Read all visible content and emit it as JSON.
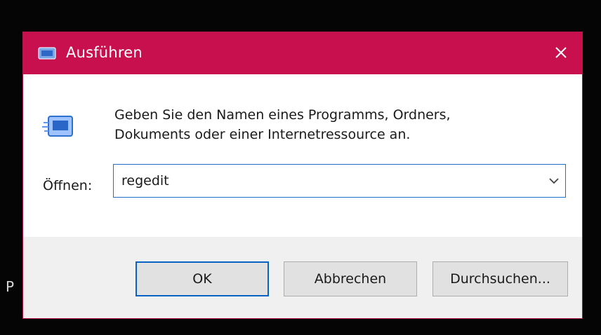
{
  "background": {
    "partial_char": "P"
  },
  "dialog": {
    "title": "Ausführen",
    "icon": "run-app-icon",
    "close_icon": "close-icon",
    "description_line1": "Geben Sie den Namen eines Programms, Ordners,",
    "description_line2": "Dokuments oder einer Internetressource an.",
    "open_label": "Öffnen:",
    "open_value": "regedit",
    "dropdown_icon": "chevron-down-icon",
    "buttons": {
      "ok": "OK",
      "cancel": "Abbrechen",
      "browse": "Durchsuchen..."
    }
  },
  "colors": {
    "titlebar": "#c8104f",
    "accent": "#1f70c9",
    "button_face": "#e1e1e1",
    "footer": "#f0f0f0"
  }
}
